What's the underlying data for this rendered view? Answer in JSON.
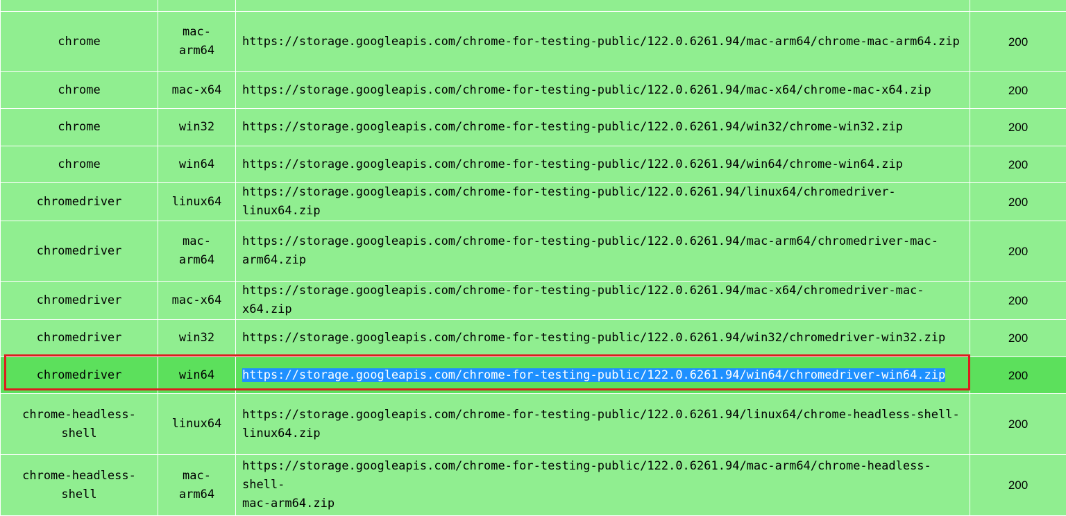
{
  "colors": {
    "row_background": "#90ee90",
    "highlighted_row_background": "#5ce05c",
    "text_selection": "#1e90ff",
    "selection_outline": "#dc1e1e"
  },
  "rows": [
    {
      "binary": "",
      "platform": "",
      "url": "",
      "status": ""
    },
    {
      "binary": "chrome",
      "platform": "mac-\narm64",
      "url": "https://storage.googleapis.com/chrome-for-testing-public/122.0.6261.94/mac-arm64/chrome-mac-arm64.zip",
      "status": "200"
    },
    {
      "binary": "chrome",
      "platform": "mac-x64",
      "url": "https://storage.googleapis.com/chrome-for-testing-public/122.0.6261.94/mac-x64/chrome-mac-x64.zip",
      "status": "200"
    },
    {
      "binary": "chrome",
      "platform": "win32",
      "url": "https://storage.googleapis.com/chrome-for-testing-public/122.0.6261.94/win32/chrome-win32.zip",
      "status": "200"
    },
    {
      "binary": "chrome",
      "platform": "win64",
      "url": "https://storage.googleapis.com/chrome-for-testing-public/122.0.6261.94/win64/chrome-win64.zip",
      "status": "200"
    },
    {
      "binary": "chromedriver",
      "platform": "linux64",
      "url": "https://storage.googleapis.com/chrome-for-testing-public/122.0.6261.94/linux64/chromedriver-linux64.zip",
      "status": "200"
    },
    {
      "binary": "chromedriver",
      "platform": "mac-\narm64",
      "url": "https://storage.googleapis.com/chrome-for-testing-public/122.0.6261.94/mac-arm64/chromedriver-mac-\narm64.zip",
      "status": "200"
    },
    {
      "binary": "chromedriver",
      "platform": "mac-x64",
      "url": "https://storage.googleapis.com/chrome-for-testing-public/122.0.6261.94/mac-x64/chromedriver-mac-x64.zip",
      "status": "200"
    },
    {
      "binary": "chromedriver",
      "platform": "win32",
      "url": "https://storage.googleapis.com/chrome-for-testing-public/122.0.6261.94/win32/chromedriver-win32.zip",
      "status": "200"
    },
    {
      "binary": "chromedriver",
      "platform": "win64",
      "url": "https://storage.googleapis.com/chrome-for-testing-public/122.0.6261.94/win64/chromedriver-win64.zip",
      "status": "200",
      "selected": true
    },
    {
      "binary": "chrome-headless-\nshell",
      "platform": "linux64",
      "url": "https://storage.googleapis.com/chrome-for-testing-public/122.0.6261.94/linux64/chrome-headless-shell-\nlinux64.zip",
      "status": "200"
    },
    {
      "binary": "chrome-headless-\nshell",
      "platform": "mac-\narm64",
      "url": "https://storage.googleapis.com/chrome-for-testing-public/122.0.6261.94/mac-arm64/chrome-headless-shell-\nmac-arm64.zip",
      "status": "200"
    }
  ]
}
